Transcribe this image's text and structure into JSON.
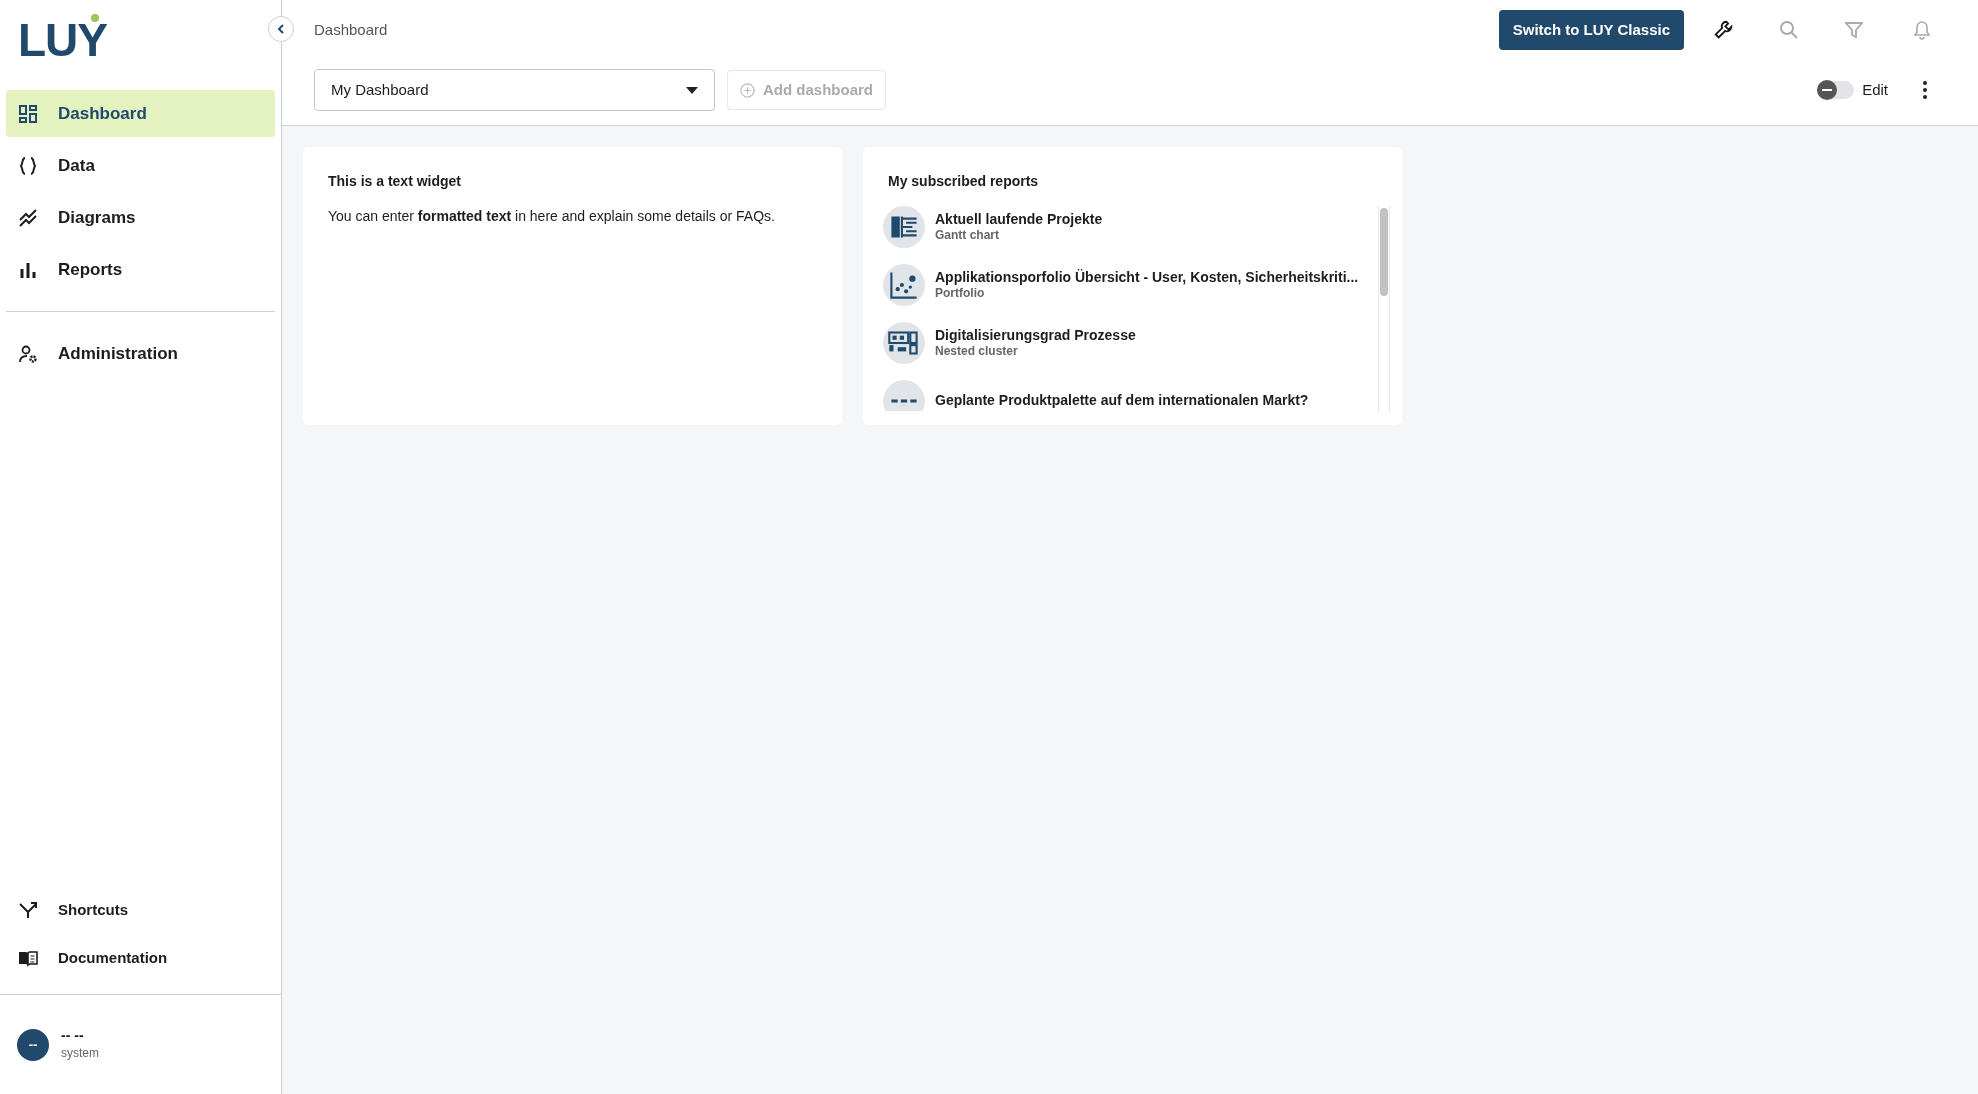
{
  "logo": "LUY",
  "sidebar": {
    "items": [
      {
        "label": "Dashboard",
        "kind": "grid",
        "selected": true
      },
      {
        "label": "Data",
        "kind": "braces",
        "selected": false
      },
      {
        "label": "Diagrams",
        "kind": "chart-line",
        "selected": false
      },
      {
        "label": "Reports",
        "kind": "bars",
        "selected": false
      }
    ],
    "admin": [
      {
        "label": "Administration",
        "kind": "user-gear",
        "selected": false
      }
    ],
    "bottom": [
      {
        "label": "Shortcuts",
        "kind": "split"
      },
      {
        "label": "Documentation",
        "kind": "book"
      }
    ],
    "user": {
      "initials": "--",
      "name": "-- --",
      "role": "system"
    }
  },
  "breadcrumb": "Dashboard",
  "header_button": "Switch to LUY Classic",
  "dashboard_select": {
    "value": "My Dashboard"
  },
  "add_dashboard": {
    "label": "Add dashboard",
    "disabled": true
  },
  "edit_toggle": {
    "label": "Edit",
    "on": false
  },
  "widgets": [
    {
      "kind": "text",
      "title": "This is a text widget",
      "body": "You can enter **formatted text** in here and explain some details or FAQs."
    },
    {
      "kind": "reports",
      "title": "My subscribed reports",
      "items": [
        {
          "kind": "gantt",
          "title": "Aktuell laufende Projekte",
          "subtitle": "Gantt chart"
        },
        {
          "kind": "portfolio",
          "title": "Applikationsporfolio Übersicht - User, Kosten, Sicherheitskriti...",
          "subtitle": "Portfolio"
        },
        {
          "kind": "cluster",
          "title": "Digitalisierungsgrad Prozesse",
          "subtitle": "Nested cluster"
        },
        {
          "kind": "list",
          "title": "Geplante Produktpalette auf dem internationalen Markt?"
        }
      ]
    }
  ]
}
